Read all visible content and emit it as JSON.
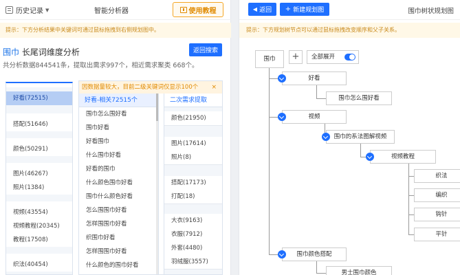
{
  "left": {
    "history_label": "历史记录",
    "app_title": "智能分析器",
    "tutorial_label": "使用教程",
    "tip": "提示：下方分析结果中关键词可通过鼠标拖拽到右侧规划图中。",
    "keyword": "围巾",
    "keyword_suffix": " 长尾词维度分析",
    "back_search": "返回搜索",
    "stats": "共分析数据844541条，提取出需求997个，相近需求聚类 668个。",
    "notice": "因数据量较大，目前二级关键词仅显示100个",
    "notice_close": "×",
    "col1_items": [
      {
        "label": "好看(72515)",
        "selected": true
      },
      {
        "label": "搭配(51646)"
      },
      {
        "label": "颜色(50291)"
      },
      {
        "label": "图片(46267)"
      },
      {
        "label": "照片(1384)"
      },
      {
        "label": "视频(43554)"
      },
      {
        "label": "视频教程(20345)"
      },
      {
        "label": "教程(17508)"
      },
      {
        "label": "织法(40454)"
      }
    ],
    "col2_header": "好看-相关72515个",
    "col2_items": [
      "围巾怎么围好看",
      "围巾好看",
      "好看围巾",
      "什么围巾好看",
      "好看的围巾",
      "什么颜色围巾好看",
      "围巾什么颜色好看",
      "怎么围围巾好看",
      "怎样围围巾好看",
      "织围巾好看",
      "怎样围围巾好看",
      "什么颜色的围巾好看"
    ],
    "col3_header": "二次需求提取",
    "col3_groups": [
      [
        "颜色(21950)"
      ],
      [
        "图片(17614)",
        "照片(8)"
      ],
      [
        "搭配(17173)",
        "打配(18)"
      ],
      [
        "大衣(9163)",
        "衣服(7912)",
        "外套(4480)",
        "羽绒服(3557)"
      ]
    ]
  },
  "right": {
    "back_label": "返回",
    "new_plan_label": "新建规划图",
    "title": "围巾树状规划图",
    "tip": "提示：下方规划树节点可以通过鼠标拖拽改变顺序和父子关系。",
    "root": "围巾",
    "expand_all": "全部展开",
    "nodes": {
      "n1": "好看",
      "n1a": "围巾怎么围好看",
      "n2": "视频",
      "n2a": "围巾的系法图解视频",
      "n2b": "视频教程",
      "n2b1": "织法",
      "n2b2": "编织",
      "n2b3": "钩针",
      "n2b4": "平针",
      "n3": "围巾颜色搭配",
      "n3a": "男士围巾颜色"
    }
  }
}
